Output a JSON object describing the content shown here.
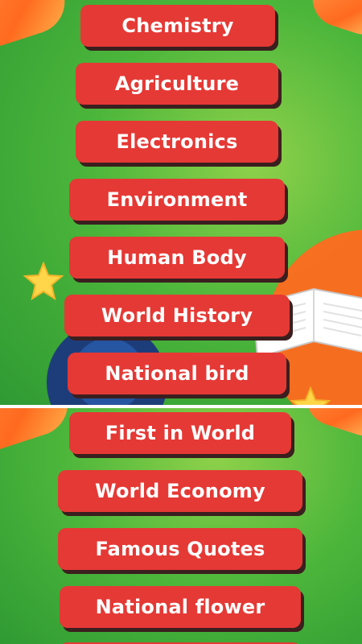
{
  "top_buttons": [
    {
      "label": "Chemistry"
    },
    {
      "label": "Agriculture"
    },
    {
      "label": "Electronics"
    },
    {
      "label": "Environment"
    },
    {
      "label": "Human Body"
    },
    {
      "label": "World History"
    },
    {
      "label": "National bird"
    }
  ],
  "bottom_buttons": [
    {
      "label": "First in World"
    },
    {
      "label": "World Economy"
    },
    {
      "label": "Famous Quotes"
    },
    {
      "label": "National flower"
    }
  ],
  "colors": {
    "button": "#e53935",
    "button_shadow": "#3b1f1f",
    "background_green": "#4cb63b",
    "accent_orange": "#ff6a1f",
    "star_yellow": "#ffd54a"
  },
  "icons": [
    "star-icon",
    "book-icon"
  ]
}
